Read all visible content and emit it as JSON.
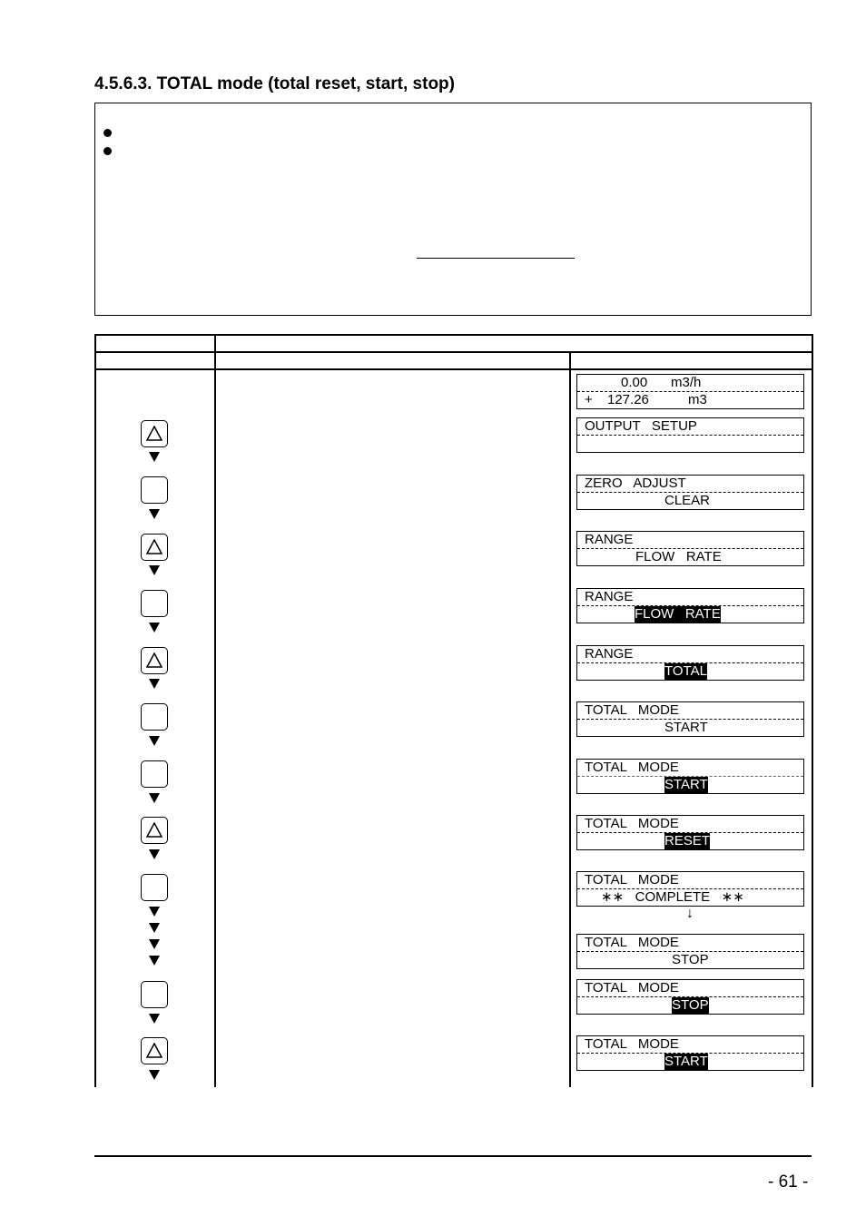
{
  "document": {
    "section_title": "4.5.6.3. TOTAL mode (total reset, start, stop)",
    "page_number": "- 61 -"
  },
  "note_box": {
    "bullets": [
      "",
      ""
    ]
  },
  "table": {
    "header_row1": [
      "",
      ""
    ],
    "header_row2": [
      "",
      "",
      ""
    ]
  },
  "keys": [
    {
      "icon": "up-triangle-key",
      "label": ""
    },
    {
      "icon": "blank-key",
      "label": ""
    },
    {
      "icon": "up-triangle-key",
      "label": ""
    },
    {
      "icon": "blank-key",
      "label": ""
    },
    {
      "icon": "up-triangle-key",
      "label": ""
    },
    {
      "icon": "blank-key",
      "label": ""
    },
    {
      "icon": "blank-key",
      "label": ""
    },
    {
      "icon": "up-triangle-key",
      "label": ""
    },
    {
      "icon": "blank-key",
      "label": ""
    },
    {
      "icon": "blank-key",
      "label": ""
    },
    {
      "icon": "up-triangle-key",
      "label": ""
    }
  ],
  "displays": [
    {
      "line1": "0.00",
      "line1b": "m3/h",
      "line2": "+",
      "line2b": "127.26",
      "line2c": "m3"
    },
    {
      "line1": "OUTPUT   SETUP",
      "line2": ""
    },
    {
      "line1": "ZERO   ADJUST",
      "line2": "CLEAR",
      "line2_highlight": false
    },
    {
      "line1": "RANGE",
      "line2": "FLOW   RATE",
      "line2_highlight": false
    },
    {
      "line1": "RANGE",
      "line2": "FLOW   RATE",
      "line2_highlight": true
    },
    {
      "line1": "RANGE",
      "line2": "TOTAL",
      "line2_highlight": true
    },
    {
      "line1": "TOTAL   MODE",
      "line2": "START",
      "line2_highlight": false
    },
    {
      "line1": "TOTAL   MODE",
      "line2": "START",
      "line2_highlight": true
    },
    {
      "line1": "TOTAL   MODE",
      "line2": "RESET",
      "line2_highlight": true
    },
    {
      "line1": "TOTAL   MODE",
      "line2": "∗∗   COMPLETE   ∗∗",
      "line2_highlight": false
    },
    {
      "line1": "TOTAL   MODE",
      "line2": "STOP",
      "line2_highlight": false
    },
    {
      "line1": "TOTAL   MODE",
      "line2": "STOP",
      "line2_highlight": true
    },
    {
      "line1": "TOTAL   MODE",
      "line2": "START",
      "line2_highlight": true
    }
  ],
  "transition_arrow": "↓"
}
